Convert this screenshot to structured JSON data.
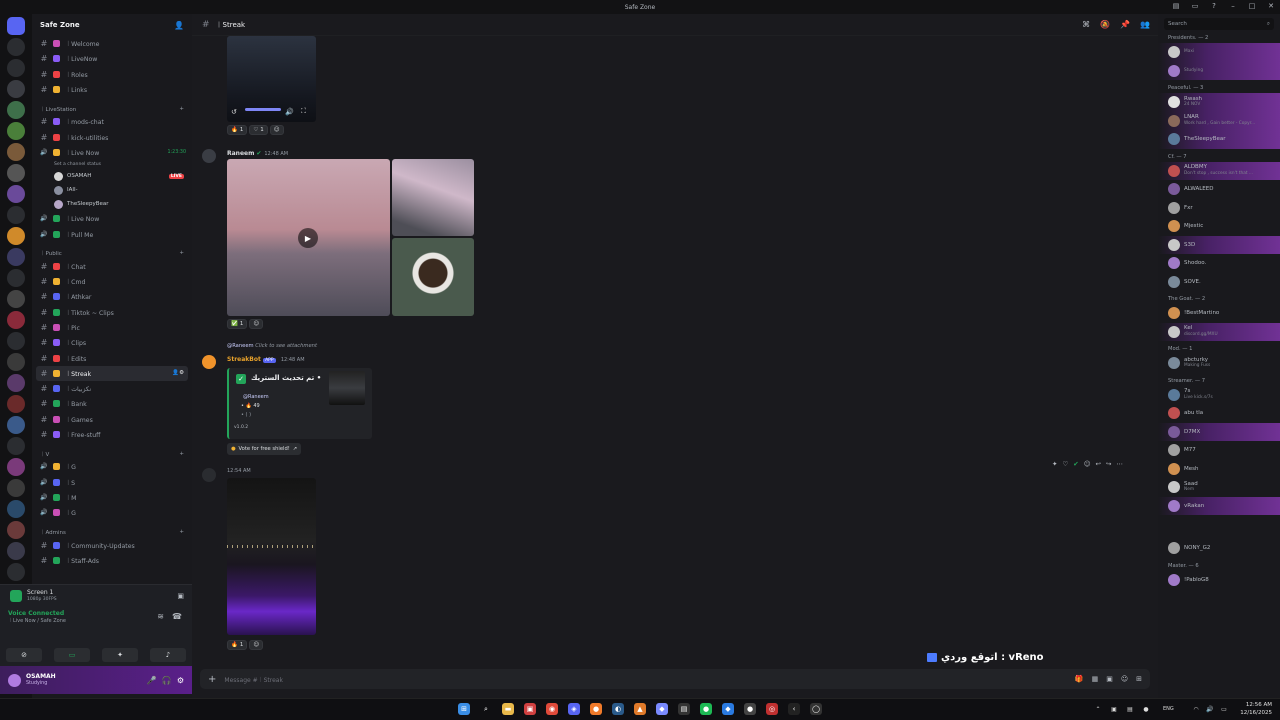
{
  "window": {
    "title": "Safe Zone"
  },
  "server": {
    "name": "Safe Zone",
    "categories": [
      {
        "name": "",
        "channels": [
          {
            "name": "︱Welcome",
            "icon": "hash"
          },
          {
            "name": "︱LiveNow",
            "icon": "hash"
          },
          {
            "name": "︱Roles",
            "icon": "hash"
          },
          {
            "name": "︱Links",
            "icon": "hash"
          }
        ]
      },
      {
        "name": "︱LiveStation",
        "channels": [
          {
            "name": "︱mods-chat",
            "icon": "hash"
          },
          {
            "name": "︱kick-utilities",
            "icon": "hash"
          },
          {
            "name": "︱Live Now",
            "icon": "speaker",
            "status": "Set a channel status",
            "timer": "1:23:30"
          }
        ]
      },
      {
        "name": "︱Public",
        "channels": [
          {
            "name": "︱Chat",
            "icon": "hash"
          },
          {
            "name": "︱Cmd",
            "icon": "hash"
          },
          {
            "name": "︱Athkar",
            "icon": "hash"
          },
          {
            "name": "︱Tiktok ~ Clips",
            "icon": "hash"
          },
          {
            "name": "︱Pic",
            "icon": "hash"
          },
          {
            "name": "︱Clips",
            "icon": "hash"
          },
          {
            "name": "︱Edits",
            "icon": "hash"
          },
          {
            "name": "︱Streak",
            "icon": "hash",
            "active": true
          },
          {
            "name": "︱نكزبيات",
            "icon": "hash"
          },
          {
            "name": "︱Bank",
            "icon": "hash"
          },
          {
            "name": "︱Games",
            "icon": "hash"
          },
          {
            "name": "︱Free-stuff",
            "icon": "hash"
          }
        ]
      },
      {
        "name": "︱V",
        "channels": [
          {
            "name": "︱G",
            "icon": "speaker"
          },
          {
            "name": "︱S",
            "icon": "speaker"
          },
          {
            "name": "︱M",
            "icon": "speaker"
          },
          {
            "name": "︱G",
            "icon": "speaker"
          }
        ]
      },
      {
        "name": "︱Admins",
        "channels": [
          {
            "name": "︱Community-Updates",
            "icon": "hash"
          },
          {
            "name": "︱Staff-Ads",
            "icon": "hash"
          }
        ]
      }
    ],
    "voice_users": [
      {
        "name": "OSAMAH",
        "live": "LIVE"
      },
      {
        "name": "IAII-"
      },
      {
        "name": "TheSleepyBear"
      }
    ],
    "extra_voice": [
      {
        "name": "︱Live Now"
      },
      {
        "name": "︱Pull Me"
      }
    ]
  },
  "screen_panel": {
    "title": "Screen 1",
    "sub": "1080p 30FPS"
  },
  "voice_panel": {
    "status": "Voice Connected",
    "location": "︱Live Now / Safe Zone"
  },
  "user_panel": {
    "name": "OSAMAH",
    "status": "Studying"
  },
  "channel": {
    "name": "︱Streak",
    "composer_placeholder": "Message #︱Streak"
  },
  "messages": [
    {
      "reactions": [
        {
          "emoji": "🔥",
          "count": "1"
        },
        {
          "emoji": "♡",
          "count": "1"
        }
      ]
    },
    {
      "author": "Raneem",
      "time": "12:48 AM",
      "reactions": [
        {
          "emoji": "✅",
          "count": "1"
        }
      ]
    },
    {
      "reply_to": "@Raneem",
      "reply_text": "Click to see attachment",
      "author": "StreakBot",
      "bot_tag": "APP",
      "time": "12:48 AM",
      "embed": {
        "title": "تم تحديث الستريك •",
        "mention": "@Raneem",
        "line1": "• 🔥 49",
        "line2": "• (  )",
        "version": "v1.0.2"
      },
      "button": "Vote for free shield!"
    },
    {
      "time": "12:54 AM",
      "reactions": [
        {
          "emoji": "🔥",
          "count": "1"
        }
      ]
    }
  ],
  "overlay": {
    "text": "اتوقع وردي : vReno"
  },
  "members": {
    "search_placeholder": "Search",
    "groups": [
      {
        "title": "Presidents. — 2",
        "members": [
          {
            "name": "",
            "sub": "Maxi",
            "banner": true
          },
          {
            "name": "",
            "sub": "Studying",
            "banner": true
          }
        ]
      },
      {
        "title": "Peaceful. — 3",
        "members": [
          {
            "name": "Rwash",
            "sub": "24 NOV",
            "banner": true
          },
          {
            "name": "LNAR",
            "sub": "Work hard , Gain better - Copyr...",
            "banner": true
          },
          {
            "name": "TheSleepyBear",
            "sub": "",
            "banner": true
          }
        ]
      },
      {
        "title": "Cf. — 7",
        "members": [
          {
            "name": "ALDBMY",
            "sub": "Don't stop , success isn't that ...",
            "banner": true
          },
          {
            "name": "ALWALEED",
            "sub": ""
          },
          {
            "name": "Fxr",
            "sub": ""
          },
          {
            "name": "Mjestic",
            "sub": ""
          },
          {
            "name": "S3D",
            "sub": "",
            "banner": true
          },
          {
            "name": "Shodoo.",
            "sub": ""
          },
          {
            "name": "SOVE.",
            "sub": ""
          }
        ]
      },
      {
        "title": "The Goat. — 2",
        "members": [
          {
            "name": "!BestMartino",
            "sub": ""
          },
          {
            "name": "Kel",
            "sub": "discord.gg/MXU",
            "banner": true
          }
        ]
      },
      {
        "title": "Mod. — 1",
        "members": [
          {
            "name": "abcturky",
            "sub": "Making Fuss"
          }
        ]
      },
      {
        "title": "Streamer. — 7",
        "members": [
          {
            "name": "7s",
            "sub": "Live kick.s/7s"
          },
          {
            "name": "abu tla",
            "sub": ""
          },
          {
            "name": "D7MX",
            "sub": "",
            "banner": true
          },
          {
            "name": "M77",
            "sub": ""
          },
          {
            "name": "Mesh",
            "sub": ""
          },
          {
            "name": "Saad",
            "sub": "Nem"
          },
          {
            "name": "vRakan",
            "sub": "",
            "banner": true
          }
        ]
      },
      {
        "title": "",
        "members": [
          {
            "name": "NONY_G2",
            "sub": ""
          }
        ]
      },
      {
        "title": "Master. — 6",
        "members": [
          {
            "name": "!PabloG8",
            "sub": ""
          }
        ]
      }
    ]
  },
  "taskbar": {
    "time": "12:56 AM",
    "date": "12/16/2025",
    "lang": "ENG"
  },
  "colors": {
    "accent": "#5865f2",
    "live": "#ed4245",
    "online": "#23a55a"
  }
}
